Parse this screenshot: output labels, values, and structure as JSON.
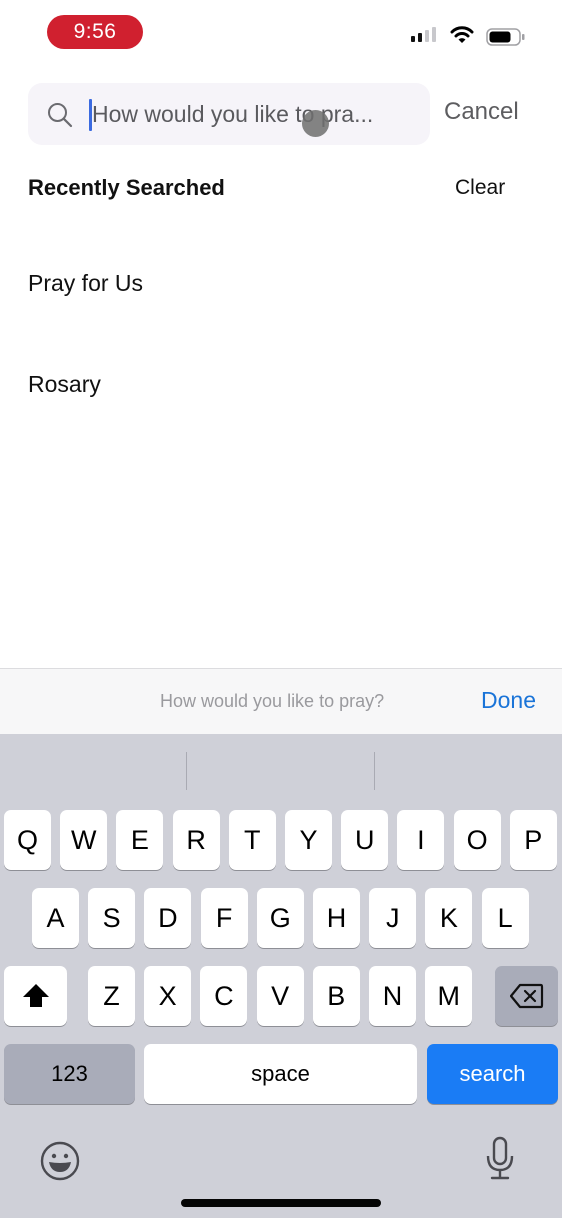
{
  "status_bar": {
    "time": "9:56",
    "time_pill_color": "#d0202f",
    "icons": [
      "cellular-signal-icon",
      "wifi-icon",
      "battery-icon"
    ]
  },
  "search": {
    "placeholder": "How would you like to pra...",
    "value": "",
    "icon": "search-icon",
    "cancel_label": "Cancel"
  },
  "recent": {
    "title": "Recently Searched",
    "clear_label": "Clear",
    "items": [
      {
        "label": "Pray for Us"
      },
      {
        "label": "Rosary"
      }
    ]
  },
  "accessory_bar": {
    "hint": "How would you like to pray?",
    "done_label": "Done",
    "done_color": "#1a74d8"
  },
  "keyboard": {
    "row1": [
      "Q",
      "W",
      "E",
      "R",
      "T",
      "Y",
      "U",
      "I",
      "O",
      "P"
    ],
    "row2": [
      "A",
      "S",
      "D",
      "F",
      "G",
      "H",
      "J",
      "K",
      "L"
    ],
    "row3": [
      "Z",
      "X",
      "C",
      "V",
      "B",
      "N",
      "M"
    ],
    "shift_icon": "shift-arrow-icon",
    "delete_icon": "delete-backspace-icon",
    "numbers_label": "123",
    "space_label": "space",
    "search_label": "search",
    "search_color": "#1a7cf5",
    "emoji_icon": "emoji-icon",
    "mic_icon": "microphone-icon"
  }
}
